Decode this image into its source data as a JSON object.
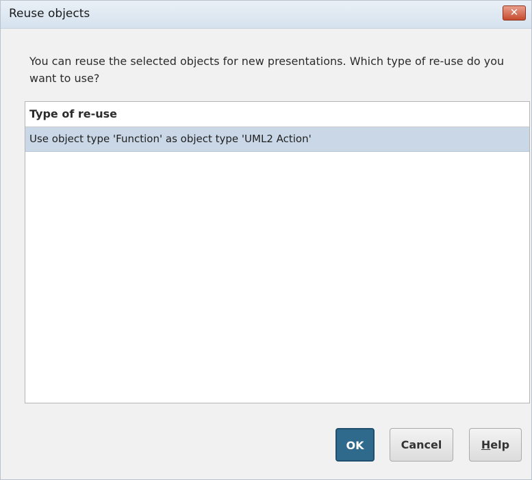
{
  "dialog": {
    "title": "Reuse objects",
    "close_icon": "close-icon",
    "message": "You can reuse the selected objects for new presentations. Which type of re-use do you want to use?"
  },
  "list": {
    "header": "Type of re-use",
    "rows": [
      {
        "label": "Use object type 'Function' as object type 'UML2 Action'",
        "selected": true
      }
    ]
  },
  "buttons": {
    "ok": "OK",
    "cancel": "Cancel",
    "help_mnemonic": "H",
    "help_rest": "elp"
  },
  "colors": {
    "selection": "#c9d7e6",
    "primary_button": "#2f6a8d",
    "close_button": "#c64b2e"
  }
}
